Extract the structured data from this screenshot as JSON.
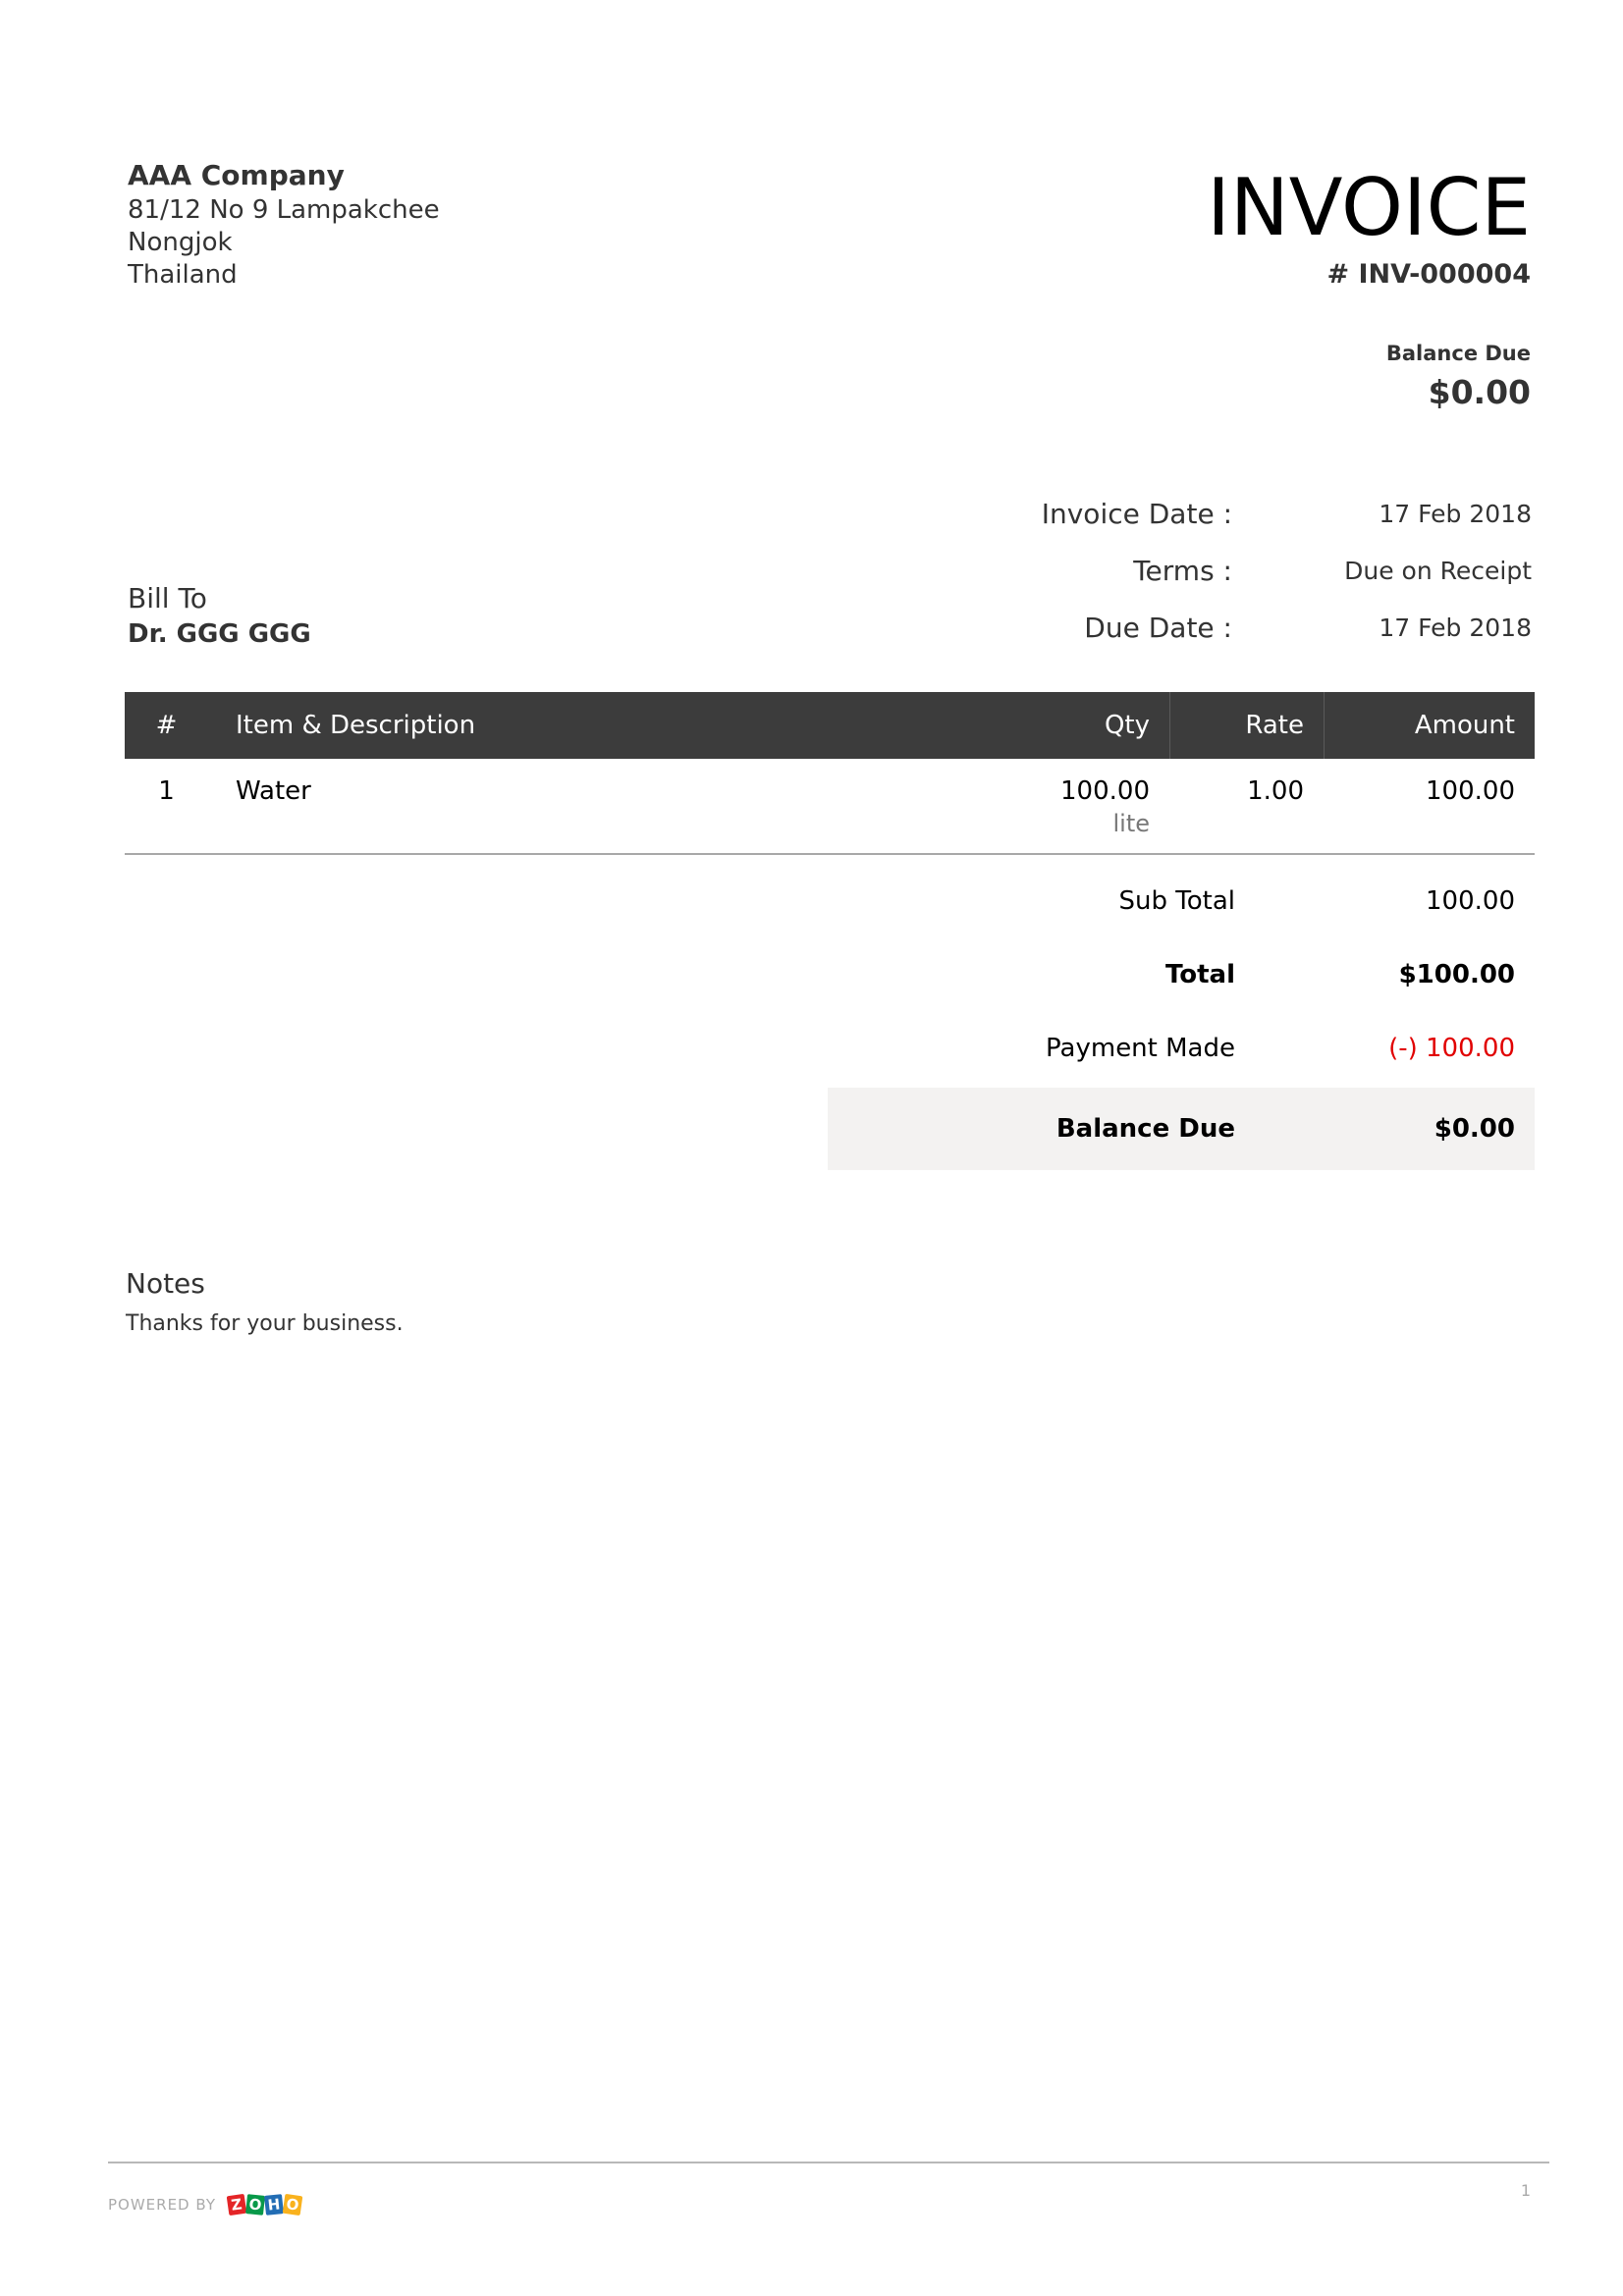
{
  "company": {
    "name": "AAA Company",
    "address_lines": [
      "81/12 No 9 Lampakchee",
      "Nongjok",
      "Thailand"
    ]
  },
  "invoice": {
    "title": "INVOICE",
    "number": "# INV-000004",
    "balance_due_label": "Balance Due",
    "balance_due_amount": "$0.00"
  },
  "meta": [
    {
      "label": "Invoice Date :",
      "value": "17 Feb 2018"
    },
    {
      "label": "Terms :",
      "value": "Due on Receipt"
    },
    {
      "label": "Due Date :",
      "value": "17 Feb 2018"
    }
  ],
  "bill_to": {
    "label": "Bill To",
    "name": "Dr. GGG GGG"
  },
  "table": {
    "headers": {
      "num": "#",
      "desc": "Item & Description",
      "qty": "Qty",
      "rate": "Rate",
      "amount": "Amount"
    },
    "rows": [
      {
        "num": "1",
        "desc": "Water",
        "qty": "100.00",
        "unit": "lite",
        "rate": "1.00",
        "amount": "100.00"
      }
    ]
  },
  "totals": {
    "sub_total_label": "Sub Total",
    "sub_total_value": "100.00",
    "total_label": "Total",
    "total_value": "$100.00",
    "payment_label": "Payment Made",
    "payment_value": "(-) 100.00",
    "balance_label": "Balance Due",
    "balance_value": "$0.00"
  },
  "notes": {
    "label": "Notes",
    "text": "Thanks for your business."
  },
  "footer": {
    "powered_by": "POWERED BY",
    "zoho_letters": [
      "Z",
      "O",
      "H",
      "O"
    ],
    "page_number": "1"
  },
  "colors": {
    "table_header_bg": "#3c3c3c",
    "payment_red": "#e10000",
    "balance_bg": "#f3f2f1"
  }
}
